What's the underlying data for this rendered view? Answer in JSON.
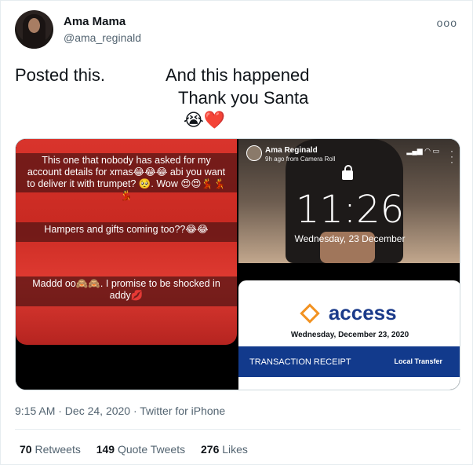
{
  "user": {
    "name": "Ama Mama",
    "handle": "@ama_reginald"
  },
  "more_icon": "ooo",
  "tweet": {
    "line1a": "Posted this.",
    "line1b": "And this happened",
    "line2": "Thank you Santa",
    "line3": "😭❤️"
  },
  "media": {
    "left": {
      "caption1": "This one that nobody has asked for my account details for xmas😂😂😂 abi you want to deliver it with trumpet? 🥺. Wow 😍😍💃💃💃",
      "caption2": "Hampers and gifts coming too??😂😂",
      "caption3": "Maddd oo🙈🙈. I promise to be shocked in addy💋"
    },
    "top_right": {
      "user": "Ama Reginald",
      "sub": "9h ago from Camera Roll",
      "time": "11:26",
      "date": "Wednesday, 23 December",
      "menu_icon": "vertical-dots-icon"
    },
    "bottom_right": {
      "brand": "access",
      "date": "Wednesday, December 23, 2020",
      "receipt_label": "TRANSACTION RECEIPT",
      "transfer_type": "Local Transfer"
    }
  },
  "meta": "9:15 AM · Dec 24, 2020 · Twitter for iPhone",
  "stats": {
    "retweets_count": "70",
    "retweets_label": "Retweets",
    "quotes_count": "149",
    "quotes_label": "Quote Tweets",
    "likes_count": "276",
    "likes_label": "Likes"
  }
}
